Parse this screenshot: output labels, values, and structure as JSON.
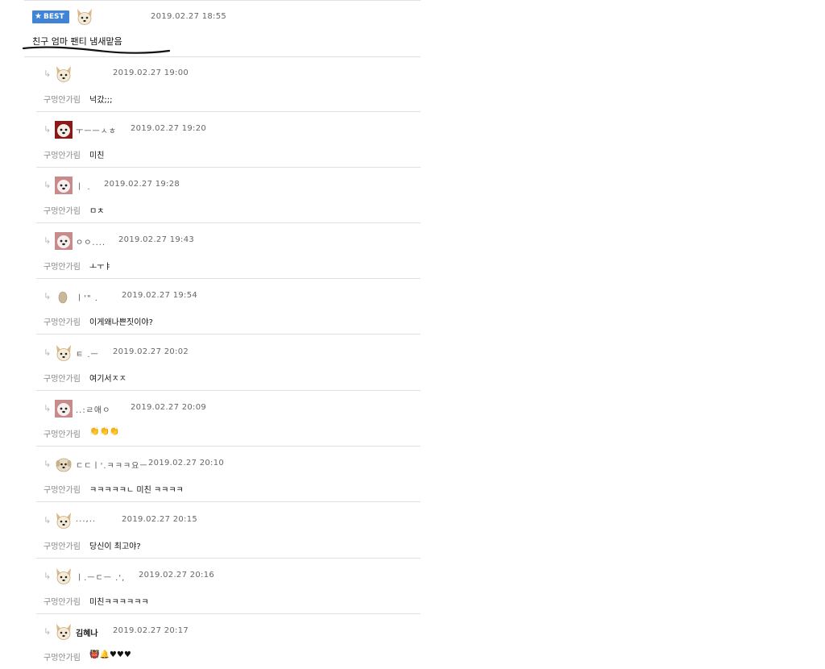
{
  "best": {
    "badge": "BEST",
    "timestamp": "2019.02.27 18:55",
    "text": "친구 엄마 팬티 냄새맡음"
  },
  "replies": [
    {
      "nickname": "",
      "timestamp": "2019.02.27 19:00",
      "target": "구멍안가림",
      "message": "넉갔;;;",
      "avatar": "dog-white-icon"
    },
    {
      "nickname": "ㅜㅡㅡㅅㅎ",
      "timestamp": "2019.02.27 19:20",
      "target": "구멍안가림",
      "message": "미친",
      "avatar": "dog-red-icon"
    },
    {
      "nickname": "ㅣ  .",
      "timestamp": "2019.02.27 19:28",
      "target": "구멍안가림",
      "message": "ㅁㅊ",
      "avatar": "dog-pink-icon"
    },
    {
      "nickname": "ㅇㅇ....",
      "timestamp": "2019.02.27 19:43",
      "target": "구멍안가림",
      "message": "ㅗㅜㅑ",
      "avatar": "dog-pink-icon"
    },
    {
      "nickname": "ㅣ'\"    .",
      "timestamp": "2019.02.27 19:54",
      "target": "구멍안가림",
      "message": "이게왜나쁜짓이야?",
      "avatar": "egg-icon"
    },
    {
      "nickname": "ㅌ  .ㅡ",
      "timestamp": "2019.02.27 20:02",
      "target": "구멍안가림",
      "message": "여기서ㅈㅈ",
      "avatar": "dog-white-icon"
    },
    {
      "nickname": "..:ㄹ애ㅇ",
      "timestamp": "2019.02.27 20:09",
      "target": "구멍안가림",
      "message": "👏👏👏",
      "avatar": "dog-pink-icon"
    },
    {
      "nickname": "ㄷㄷㅣ'.ㅋㅋㅋ요ㅡ",
      "timestamp": "2019.02.27 20:10",
      "target": "구멍안가림",
      "message": "ㅋㅋㅋㅋㅋㄴ 미친 ㅋㅋㅋㅋ",
      "avatar": "puppy-icon"
    },
    {
      "nickname": "...,..",
      "timestamp": "2019.02.27 20:15",
      "target": "구멍안가림",
      "message": "당신이 최고야?",
      "avatar": "dog-white-icon"
    },
    {
      "nickname": "ㅣ.ㅡㄷㅡ  .',",
      "timestamp": "2019.02.27 20:16",
      "target": "구멍안가림",
      "message": "미친ㅋㅋㅋㅋㅋㅋ",
      "avatar": "dog-white-icon"
    },
    {
      "nickname": "김혜나",
      "timestamp": "2019.02.27 20:17",
      "target": "구멍안가림",
      "message": "👹🔔♥♥♥",
      "avatar": "dog-white-icon"
    }
  ],
  "colors": {
    "badge": "#3f84d6",
    "divider": "#e0e0e0",
    "muted": "#888888"
  }
}
